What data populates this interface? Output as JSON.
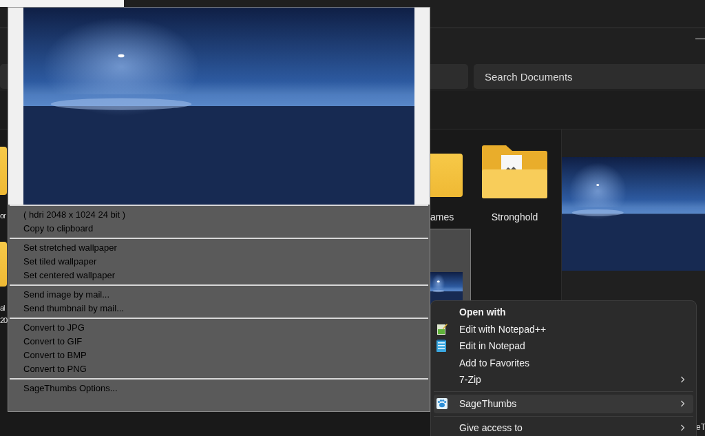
{
  "explorer": {
    "window_control": "—",
    "search": {
      "placeholder": "Search Documents"
    },
    "left_items": [
      {
        "lines": [
          "or"
        ]
      },
      {
        "lines": [
          "al",
          "20"
        ]
      }
    ],
    "cut_folder": {
      "label": "ames"
    },
    "folder": {
      "label": "Stronghold"
    },
    "preview_label": "eT"
  },
  "sagethumbs_popup": {
    "groups": [
      [
        "( hdri 2048 x 1024 24 bit )",
        "Copy to clipboard"
      ],
      [
        "Set stretched wallpaper",
        "Set tiled wallpaper",
        "Set centered wallpaper"
      ],
      [
        "Send image by mail...",
        "Send thumbnail by mail..."
      ],
      [
        "Convert to JPG",
        "Convert to GIF",
        "Convert to BMP",
        "Convert to PNG"
      ],
      [
        "SageThumbs Options..."
      ]
    ]
  },
  "context_menu": {
    "groups": [
      [
        {
          "label": "Open with",
          "kind": "heading",
          "submenu": false,
          "selected": false
        },
        {
          "label": "Edit with Notepad++",
          "kind": "notepadpp",
          "submenu": false,
          "selected": false
        },
        {
          "label": "Edit in Notepad",
          "kind": "notepad",
          "submenu": false,
          "selected": false
        },
        {
          "label": "Add to Favorites",
          "kind": "plain",
          "submenu": false,
          "selected": false
        },
        {
          "label": "7-Zip",
          "kind": "plain",
          "submenu": true,
          "selected": false
        }
      ],
      [
        {
          "label": "SageThumbs",
          "kind": "sagethumbs",
          "submenu": true,
          "selected": true
        }
      ],
      [
        {
          "label": "Give access to",
          "kind": "plain",
          "submenu": true,
          "selected": false
        }
      ]
    ]
  }
}
